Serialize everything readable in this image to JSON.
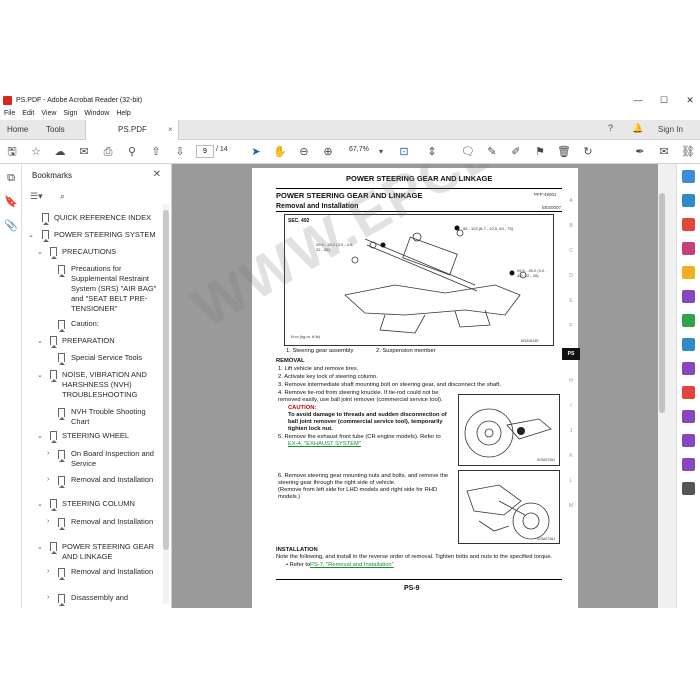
{
  "window": {
    "title": "PS.PDF - Adobe Acrobat Reader (32-bit)",
    "controls": [
      "—",
      "☐",
      "✕"
    ]
  },
  "menu": [
    "File",
    "Edit",
    "View",
    "Sign",
    "Window",
    "Help"
  ],
  "tabs": {
    "home": "Home",
    "tools": "Tools",
    "doc": "PS.PDF",
    "close": "×",
    "sign_in": "Sign In"
  },
  "toolbar": {
    "page_current": "9",
    "page_total": "/ 14",
    "zoom": "67,7%"
  },
  "bookmarks": {
    "title": "Bookmarks",
    "close": "✕",
    "items": [
      {
        "label": "QUICK REFERENCE INDEX",
        "level": 0,
        "chevron": ""
      },
      {
        "label": "POWER STEERING SYSTEM",
        "level": 0,
        "chevron": "v"
      },
      {
        "label": "PRECAUTIONS",
        "level": 1,
        "chevron": "v"
      },
      {
        "label": "Precautions for Supplemental Restraint System (SRS) \"AIR BAG\" and \"SEAT BELT PRE-TENSIONER\"",
        "level": 2,
        "chevron": ""
      },
      {
        "label": "Caution:",
        "level": 2,
        "chevron": ""
      },
      {
        "label": "PREPARATION",
        "level": 1,
        "chevron": "v"
      },
      {
        "label": "Special Service Tools",
        "level": 2,
        "chevron": ""
      },
      {
        "label": "NOISE, VIBRATION AND HARSHNESS (NVH) TROUBLESHOOTING",
        "level": 1,
        "chevron": "v"
      },
      {
        "label": "NVH Trouble Shooting Chart",
        "level": 2,
        "chevron": ""
      },
      {
        "label": "STEERING WHEEL",
        "level": 1,
        "chevron": "v"
      },
      {
        "label": "On Board Inspection and Service",
        "level": 2,
        "chevron": ">"
      },
      {
        "label": "Removal and Installation",
        "level": 2,
        "chevron": ">"
      },
      {
        "label": "STEERING COLUMN",
        "level": 1,
        "chevron": "v"
      },
      {
        "label": "Removal and Installation",
        "level": 2,
        "chevron": ">"
      },
      {
        "label": "POWER STEERING GEAR AND LINKAGE",
        "level": 1,
        "chevron": "v"
      },
      {
        "label": "Removal and Installation",
        "level": 2,
        "chevron": ">"
      },
      {
        "label": "Disassembly and",
        "level": 2,
        "chevron": ">"
      }
    ]
  },
  "pdf": {
    "header": "POWER STEERING GEAR AND LINKAGE",
    "section_title": "POWER STEERING GEAR AND LINKAGE",
    "page_code": "PFP:49001",
    "subtitle": "Removal and Installation",
    "small_code": "EES0007",
    "fig_sec": "SEC. 492",
    "torque1": "29.5 - 39.2 (3.0 - 4.0, 22 - 28)",
    "torque2": "85 - 103 (8.7 - 10.5, 63 - 75)",
    "torque3": "29.5 - 39.2 (3.0 - 4.0, 22 - 28)",
    "legend_unit": "N·m (kg-m, ft-lb)",
    "fig_id": "NGA0414E",
    "caption1": "1.     Steering gear assembly",
    "caption2": "2.     Suspension member",
    "removal": "REMOVAL",
    "steps": [
      "1.   Lift vehicle and remove tires.",
      "2.   Activate key lock of steering column.",
      "3.   Remove intermediate shaft mounting bolt on steering gear, and disconnect the shaft.",
      "4.   Remove tie-rod from steering knuckle. If tie-rod could not be",
      "      removed easily, use ball joint remover (commercial service tool)."
    ],
    "caution": "CAUTION:",
    "caution_text1": "To avoid damage to threads and sudden disconnection of",
    "caution_text2": "ball joint remover (commercial service tool), temporarily",
    "caution_text3": "tighten lock nut.",
    "step5a": "5.   Remove the exhaust front tube (CR engine models). Refer to",
    "step5_link": "EX-4, \"EXHAUST SYSTEM\"",
    "fig2_id": "SGIA0745J",
    "step6": [
      "6.   Remove steering gear mounting nuts and bolts, and remove the",
      "      steering gear through the right side of vehicle.",
      "      (Remove from left side for LHD models and right side for RHD",
      "      models.)"
    ],
    "fig3_id": "SGIA0746J",
    "installation": "INSTALLATION",
    "install_text": "Note the following, and install in the reverse order of removal. Tighten bolts and nuts to the specified torque.",
    "install_ref_pre": "•   Refer to",
    "install_link": "PS-7, \"Removal and Installation\"",
    "page_number": "PS-9",
    "side_tabs": [
      "A",
      "B",
      "C",
      "D",
      "E",
      "F",
      "PS",
      "H",
      "I",
      "J",
      "K",
      "L",
      "M"
    ],
    "watermark": "WWW.EPCDATO.COM"
  },
  "colors": {
    "acrobat_red": "#d9271c",
    "link_green": "#1a8f2e",
    "caution_red": "#d40000",
    "doc_background": "#9a9a9a"
  }
}
